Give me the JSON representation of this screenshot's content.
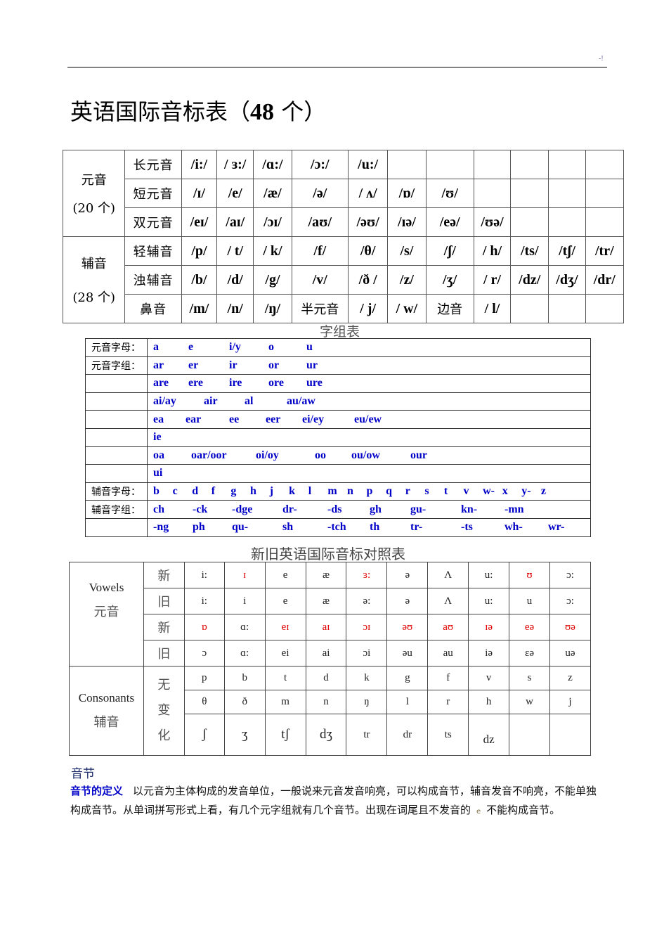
{
  "header": {
    "page_marker": "-!"
  },
  "title": {
    "text": "英语国际音标表（",
    "count": "48",
    "suffix": " 个）"
  },
  "ipa_table": {
    "vowel_category": "元音",
    "vowel_count": "(20 个)",
    "consonant_category": "辅音",
    "consonant_count": "(28 个)",
    "rows": [
      {
        "label": "长元音",
        "cells": [
          "/i:/",
          "/ ɜ:/",
          "/ɑ:/",
          "/ɔ:/",
          "/u:/",
          "",
          "",
          "",
          "",
          "",
          ""
        ]
      },
      {
        "label": "短元音",
        "cells": [
          "/ɪ/",
          "/e/",
          "/æ/",
          "/ə/",
          "/ ʌ/",
          "/ɒ/",
          "/ʊ/",
          "",
          "",
          "",
          ""
        ]
      },
      {
        "label": "双元音",
        "cells": [
          "/eɪ/",
          "/aɪ/",
          "/ɔɪ/",
          "/aʊ/",
          "/əʊ/",
          "/ɪə/",
          "/eə/",
          "/ʊə/",
          "",
          "",
          ""
        ]
      },
      {
        "label": "轻辅音",
        "cells": [
          "/p/",
          "/ t/",
          "/ k/",
          "/f/",
          "/θ/",
          "/s/",
          "/ʃ/",
          "/ h/",
          "/ts/",
          "/tʃ/",
          "/tr/"
        ]
      },
      {
        "label": "浊辅音",
        "cells": [
          "/b/",
          "/d/",
          "/g/",
          "/v/",
          "/ð /",
          "/z/",
          "/ʒ/",
          "/ r/",
          "/dz/",
          "/dʒ/",
          "/dr/"
        ]
      },
      {
        "label": "鼻音",
        "cells": [
          "/m/",
          "/n/",
          "/ŋ/",
          "半元音",
          "/ j/",
          "/ w/",
          "边音",
          "/ l/",
          "",
          "",
          ""
        ]
      }
    ]
  },
  "groups_table": {
    "title": "字组表",
    "rows": [
      {
        "label": "元音字母：",
        "items": [
          "a",
          "e",
          "i/y",
          "o",
          "u"
        ]
      },
      {
        "label": "元音字组：",
        "items": [
          "ar",
          "er",
          "ir",
          "or",
          "ur"
        ]
      },
      {
        "label": "",
        "items": [
          "are",
          "ere",
          "ire",
          "ore",
          "ure"
        ]
      },
      {
        "label": "",
        "items": [
          "ai/ay",
          "air",
          "al",
          "au/aw"
        ]
      },
      {
        "label": "",
        "items": [
          "ea",
          "ear",
          "ee",
          "eer",
          "ei/ey",
          "eu/ew"
        ]
      },
      {
        "label": "",
        "items": [
          "ie"
        ]
      },
      {
        "label": "",
        "items": [
          "oa",
          "oar/oor",
          "oi/oy",
          "oo",
          "ou/ow",
          "our"
        ]
      },
      {
        "label": "",
        "items": [
          "ui"
        ]
      },
      {
        "label": "辅音字母：",
        "items": [
          "b",
          "c",
          "d",
          "f",
          "g",
          "h",
          "j",
          "k",
          "l",
          "m",
          "n",
          "p",
          "q",
          "r",
          "s",
          "t",
          "v",
          "w-",
          "x",
          "y-",
          "z"
        ]
      },
      {
        "label": "辅音字组：",
        "items": [
          "ch",
          "-ck",
          "-dge",
          "dr-",
          "-ds",
          "gh",
          "gu-",
          "kn-",
          "-mn"
        ]
      },
      {
        "label": "",
        "items": [
          "-ng",
          "ph",
          "qu-",
          "sh",
          "-tch",
          "th",
          "tr-",
          "-ts",
          "wh-",
          "wr-"
        ]
      }
    ]
  },
  "compare_table": {
    "title": "新旧英语国际音标对照表",
    "vowels_en": "Vowels",
    "vowels_zh": "元音",
    "consonants_en": "Consonants",
    "consonants_zh": "辅音",
    "new_label": "新",
    "old_label": "旧",
    "unchanged_label": [
      "无",
      "变",
      "化"
    ],
    "vowel_rows": [
      {
        "tag": "新",
        "cells": [
          {
            "t": "i:"
          },
          {
            "t": "ɪ",
            "red": true
          },
          {
            "t": "e"
          },
          {
            "t": "æ"
          },
          {
            "t": "ɜ:",
            "red": true
          },
          {
            "t": "ə"
          },
          {
            "t": "Λ"
          },
          {
            "t": "u:"
          },
          {
            "t": "ʊ",
            "red": true
          },
          {
            "t": "ɔ:"
          }
        ]
      },
      {
        "tag": "旧",
        "cells": [
          {
            "t": "i:"
          },
          {
            "t": "i"
          },
          {
            "t": "e"
          },
          {
            "t": "æ"
          },
          {
            "t": "ə:"
          },
          {
            "t": "ə"
          },
          {
            "t": "Λ"
          },
          {
            "t": "u:"
          },
          {
            "t": "u"
          },
          {
            "t": "ɔ:"
          }
        ]
      },
      {
        "tag": "新",
        "cells": [
          {
            "t": "ɒ",
            "red": true
          },
          {
            "t": "ɑ:"
          },
          {
            "t": "eɪ",
            "red": true
          },
          {
            "t": "aɪ",
            "red": true
          },
          {
            "t": "ɔɪ",
            "red": true
          },
          {
            "t": "əʊ",
            "red": true
          },
          {
            "t": "aʊ",
            "red": true
          },
          {
            "t": "ɪə",
            "red": true
          },
          {
            "t": "eə",
            "red": true
          },
          {
            "t": "ʊə",
            "red": true
          }
        ]
      },
      {
        "tag": "旧",
        "cells": [
          {
            "t": "ɔ"
          },
          {
            "t": "ɑ:"
          },
          {
            "t": "ei"
          },
          {
            "t": "ai"
          },
          {
            "t": "ɔi"
          },
          {
            "t": "əu"
          },
          {
            "t": "au"
          },
          {
            "t": "iə"
          },
          {
            "t": "εə"
          },
          {
            "t": "uə"
          }
        ]
      }
    ],
    "consonant_rows": [
      [
        "p",
        "b",
        "t",
        "d",
        "k",
        "g",
        "f",
        "v",
        "s",
        "z"
      ],
      [
        "θ",
        "ð",
        "m",
        "n",
        "ŋ",
        "l",
        "r",
        "h",
        "w",
        "j"
      ],
      [
        "ʃ",
        "ʒ",
        "tʃ",
        "dʒ",
        "tr",
        "dr",
        "ts",
        "dz",
        "",
        ""
      ]
    ]
  },
  "syllable": {
    "heading": "音节",
    "term": "音节的定义",
    "text_1": "以元音为主体构成的发音单位，一般说来元音发音响亮，可以构成音节，辅音发音不响亮，不能单独构成音节。从单词拼写形式上看，有几个元字组就有几个音节。出现在词尾且不发音的",
    "letter": "e",
    "text_2": "不能构成音节。"
  },
  "colors": {
    "accent_blue": "#0000c8",
    "accent_red": "#e00000"
  }
}
